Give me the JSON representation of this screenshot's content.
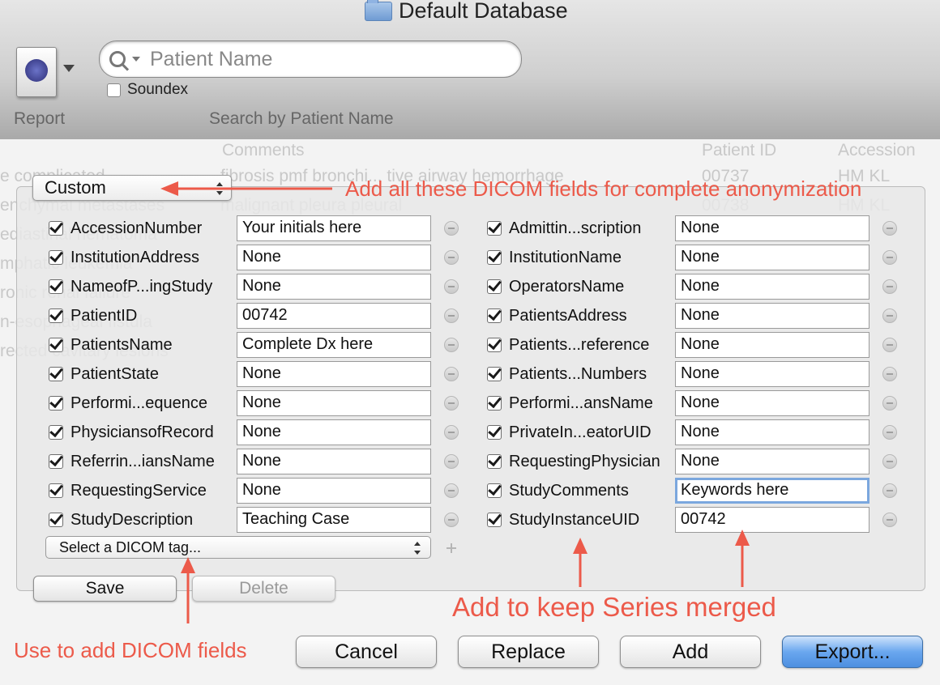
{
  "window": {
    "title": "Default Database"
  },
  "toolbar": {
    "report_label": "Report",
    "search_placeholder": "Patient Name",
    "soundex_label": "Soundex",
    "search_by_label": "Search by Patient Name"
  },
  "background_list": {
    "header": [
      "Comments",
      "Patient ID",
      "Accession"
    ],
    "rows": [
      [
        "e complicated",
        "fibrosis pmf bronchi... tive airway hemorrhage",
        "00737",
        "HM KL"
      ],
      [
        "enchymal metastases",
        "malignant pleura pleural",
        "00738",
        "HM KL"
      ],
      [
        "ediastinal hematoma",
        "",
        "",
        ""
      ],
      [
        "mphatic leukemia",
        "",
        "",
        ""
      ],
      [
        "ronic renal failure",
        "",
        "",
        ""
      ],
      [
        "n-esophageal fistula",
        "",
        "",
        ""
      ],
      [
        "rected cavitary lesions",
        "",
        "",
        ""
      ]
    ]
  },
  "preset": {
    "selected": "Custom"
  },
  "left_fields": [
    {
      "label": "AccessionNumber",
      "value": "Your initials here"
    },
    {
      "label": "InstitutionAddress",
      "value": "None"
    },
    {
      "label": "NameofP...ingStudy",
      "value": "None"
    },
    {
      "label": "PatientID",
      "value": "00742"
    },
    {
      "label": "PatientsName",
      "value": "Complete Dx here"
    },
    {
      "label": "PatientState",
      "value": "None"
    },
    {
      "label": "Performi...equence",
      "value": "None"
    },
    {
      "label": "PhysiciansofRecord",
      "value": "None"
    },
    {
      "label": "Referrin...iansName",
      "value": "None"
    },
    {
      "label": "RequestingService",
      "value": "None"
    },
    {
      "label": "StudyDescription",
      "value": "Teaching Case"
    }
  ],
  "right_fields": [
    {
      "label": "Admittin...scription",
      "value": "None"
    },
    {
      "label": "InstitutionName",
      "value": "None"
    },
    {
      "label": "OperatorsName",
      "value": "None"
    },
    {
      "label": "PatientsAddress",
      "value": "None"
    },
    {
      "label": "Patients...reference",
      "value": "None"
    },
    {
      "label": "Patients...Numbers",
      "value": "None"
    },
    {
      "label": "Performi...ansName",
      "value": "None"
    },
    {
      "label": "PrivateIn...eatorUID",
      "value": "None"
    },
    {
      "label": "RequestingPhysician",
      "value": "None"
    },
    {
      "label": "StudyComments",
      "value": "Keywords here"
    },
    {
      "label": "StudyInstanceUID",
      "value": "00742"
    }
  ],
  "tag_select": {
    "selected": "Select a DICOM tag..."
  },
  "buttons": {
    "save": "Save",
    "delete": "Delete",
    "cancel": "Cancel",
    "replace": "Replace",
    "add": "Add",
    "export": "Export..."
  },
  "annotations": {
    "anonymization": "Add all these DICOM fields for complete anonymization",
    "add_fields": "Use to add DICOM fields",
    "keep_merged": "Add to keep Series merged",
    "color": "#ec5a4a"
  }
}
